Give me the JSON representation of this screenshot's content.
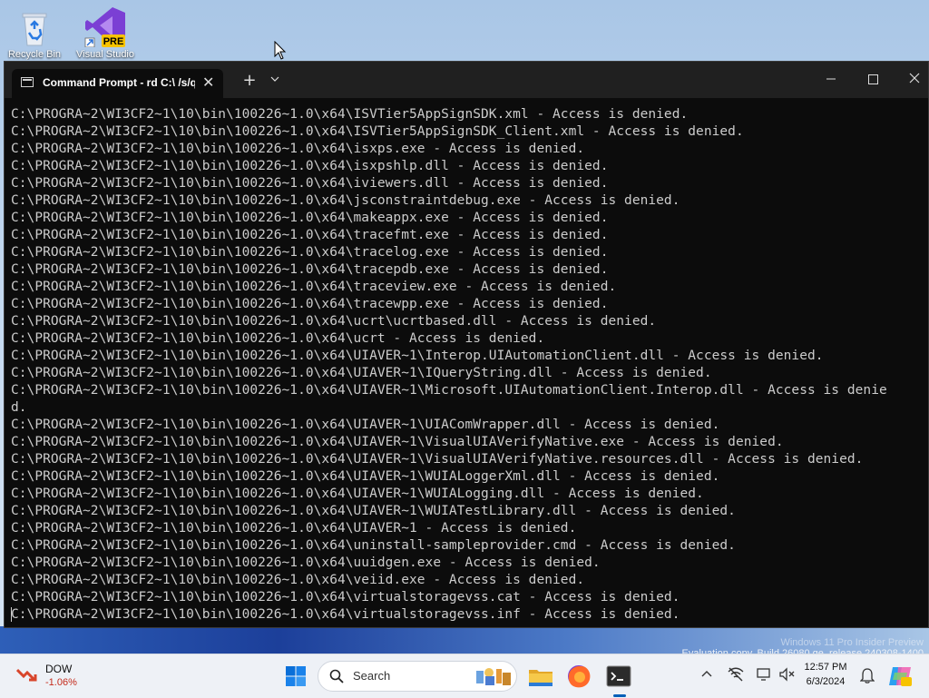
{
  "desktop": {
    "icons": [
      {
        "label": "Recycle Bin"
      },
      {
        "label": "Visual Studio",
        "badge": "PRE"
      }
    ]
  },
  "window": {
    "tab_title": "Command Prompt - rd  C:\\ /s/q",
    "new_tab": "+",
    "dropdown": "⌄",
    "minimize": "—",
    "close": "✕"
  },
  "console": {
    "lines": [
      "C:\\PROGRA~2\\WI3CF2~1\\10\\bin\\100226~1.0\\x64\\ISVTier5AppSignSDK.xml - Access is denied.",
      "C:\\PROGRA~2\\WI3CF2~1\\10\\bin\\100226~1.0\\x64\\ISVTier5AppSignSDK_Client.xml - Access is denied.",
      "C:\\PROGRA~2\\WI3CF2~1\\10\\bin\\100226~1.0\\x64\\isxps.exe - Access is denied.",
      "C:\\PROGRA~2\\WI3CF2~1\\10\\bin\\100226~1.0\\x64\\isxpshlp.dll - Access is denied.",
      "C:\\PROGRA~2\\WI3CF2~1\\10\\bin\\100226~1.0\\x64\\iviewers.dll - Access is denied.",
      "C:\\PROGRA~2\\WI3CF2~1\\10\\bin\\100226~1.0\\x64\\jsconstraintdebug.exe - Access is denied.",
      "C:\\PROGRA~2\\WI3CF2~1\\10\\bin\\100226~1.0\\x64\\makeappx.exe - Access is denied.",
      "C:\\PROGRA~2\\WI3CF2~1\\10\\bin\\100226~1.0\\x64\\tracefmt.exe - Access is denied.",
      "C:\\PROGRA~2\\WI3CF2~1\\10\\bin\\100226~1.0\\x64\\tracelog.exe - Access is denied.",
      "C:\\PROGRA~2\\WI3CF2~1\\10\\bin\\100226~1.0\\x64\\tracepdb.exe - Access is denied.",
      "C:\\PROGRA~2\\WI3CF2~1\\10\\bin\\100226~1.0\\x64\\traceview.exe - Access is denied.",
      "C:\\PROGRA~2\\WI3CF2~1\\10\\bin\\100226~1.0\\x64\\tracewpp.exe - Access is denied.",
      "C:\\PROGRA~2\\WI3CF2~1\\10\\bin\\100226~1.0\\x64\\ucrt\\ucrtbased.dll - Access is denied.",
      "C:\\PROGRA~2\\WI3CF2~1\\10\\bin\\100226~1.0\\x64\\ucrt - Access is denied.",
      "C:\\PROGRA~2\\WI3CF2~1\\10\\bin\\100226~1.0\\x64\\UIAVER~1\\Interop.UIAutomationClient.dll - Access is denied.",
      "C:\\PROGRA~2\\WI3CF2~1\\10\\bin\\100226~1.0\\x64\\UIAVER~1\\IQueryString.dll - Access is denied.",
      "C:\\PROGRA~2\\WI3CF2~1\\10\\bin\\100226~1.0\\x64\\UIAVER~1\\Microsoft.UIAutomationClient.Interop.dll - Access is denie",
      "d.",
      "C:\\PROGRA~2\\WI3CF2~1\\10\\bin\\100226~1.0\\x64\\UIAVER~1\\UIAComWrapper.dll - Access is denied.",
      "C:\\PROGRA~2\\WI3CF2~1\\10\\bin\\100226~1.0\\x64\\UIAVER~1\\VisualUIAVerifyNative.exe - Access is denied.",
      "C:\\PROGRA~2\\WI3CF2~1\\10\\bin\\100226~1.0\\x64\\UIAVER~1\\VisualUIAVerifyNative.resources.dll - Access is denied.",
      "C:\\PROGRA~2\\WI3CF2~1\\10\\bin\\100226~1.0\\x64\\UIAVER~1\\WUIALoggerXml.dll - Access is denied.",
      "C:\\PROGRA~2\\WI3CF2~1\\10\\bin\\100226~1.0\\x64\\UIAVER~1\\WUIALogging.dll - Access is denied.",
      "C:\\PROGRA~2\\WI3CF2~1\\10\\bin\\100226~1.0\\x64\\UIAVER~1\\WUIATestLibrary.dll - Access is denied.",
      "C:\\PROGRA~2\\WI3CF2~1\\10\\bin\\100226~1.0\\x64\\UIAVER~1 - Access is denied.",
      "C:\\PROGRA~2\\WI3CF2~1\\10\\bin\\100226~1.0\\x64\\uninstall-sampleprovider.cmd - Access is denied.",
      "C:\\PROGRA~2\\WI3CF2~1\\10\\bin\\100226~1.0\\x64\\uuidgen.exe - Access is denied.",
      "C:\\PROGRA~2\\WI3CF2~1\\10\\bin\\100226~1.0\\x64\\veiid.exe - Access is denied.",
      "C:\\PROGRA~2\\WI3CF2~1\\10\\bin\\100226~1.0\\x64\\virtualstoragevss.cat - Access is denied.",
      "C:\\PROGRA~2\\WI3CF2~1\\10\\bin\\100226~1.0\\x64\\virtualstoragevss.inf - Access is denied."
    ]
  },
  "watermark": {
    "line1": "Windows 11 Pro Insider Preview",
    "line2": "Evaluation copy. Build 26080.ge_release.240308-1400"
  },
  "taskbar": {
    "stock_name": "DOW",
    "stock_change": "-1.06%",
    "search_placeholder": "Search",
    "time": "12:57 PM",
    "date": "6/3/2024"
  },
  "colors": {
    "console_bg": "#0c0c0c",
    "console_text": "#cccccc",
    "accent": "#005fb8",
    "stock_down": "#c42b1c"
  }
}
